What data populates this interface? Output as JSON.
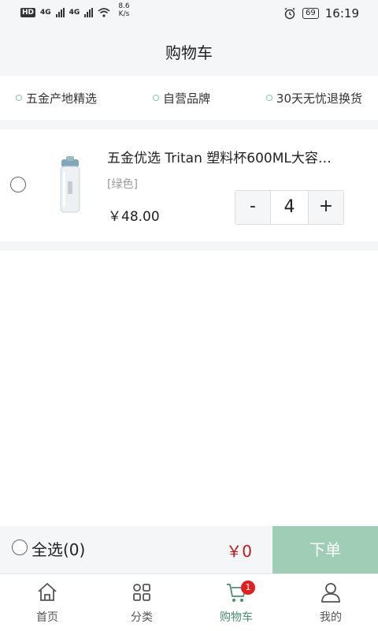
{
  "status_bar": {
    "hd": "HD",
    "network1": "4G",
    "network2": "4G",
    "speed_value": "8.6",
    "speed_unit": "K/s",
    "battery": "69",
    "time": "16:19"
  },
  "header": {
    "title": "购物车"
  },
  "features": [
    {
      "label": "五金产地精选"
    },
    {
      "label": "自营品牌"
    },
    {
      "label": "30天无忧退换货"
    }
  ],
  "cart": {
    "items": [
      {
        "title": "五金优选 Tritan 塑料杯600ML大容…",
        "variant": "[绿色]",
        "price": "￥48.00",
        "quantity": "4",
        "selected": false
      }
    ],
    "qty_minus": "-",
    "qty_plus": "+"
  },
  "checkout": {
    "select_all_label": "全选(0)",
    "total": "￥0",
    "order_button": "下单"
  },
  "tabs": [
    {
      "label": "首页",
      "icon": "home-icon"
    },
    {
      "label": "分类",
      "icon": "category-icon"
    },
    {
      "label": "购物车",
      "icon": "cart-icon",
      "badge": "1",
      "active": true
    },
    {
      "label": "我的",
      "icon": "user-icon"
    }
  ],
  "colors": {
    "accent": "#4a8f6e",
    "order_button": "#9fcdb6",
    "price_red": "#c4161c",
    "badge_red": "#e02020",
    "background_gray": "#f5f6f8"
  }
}
